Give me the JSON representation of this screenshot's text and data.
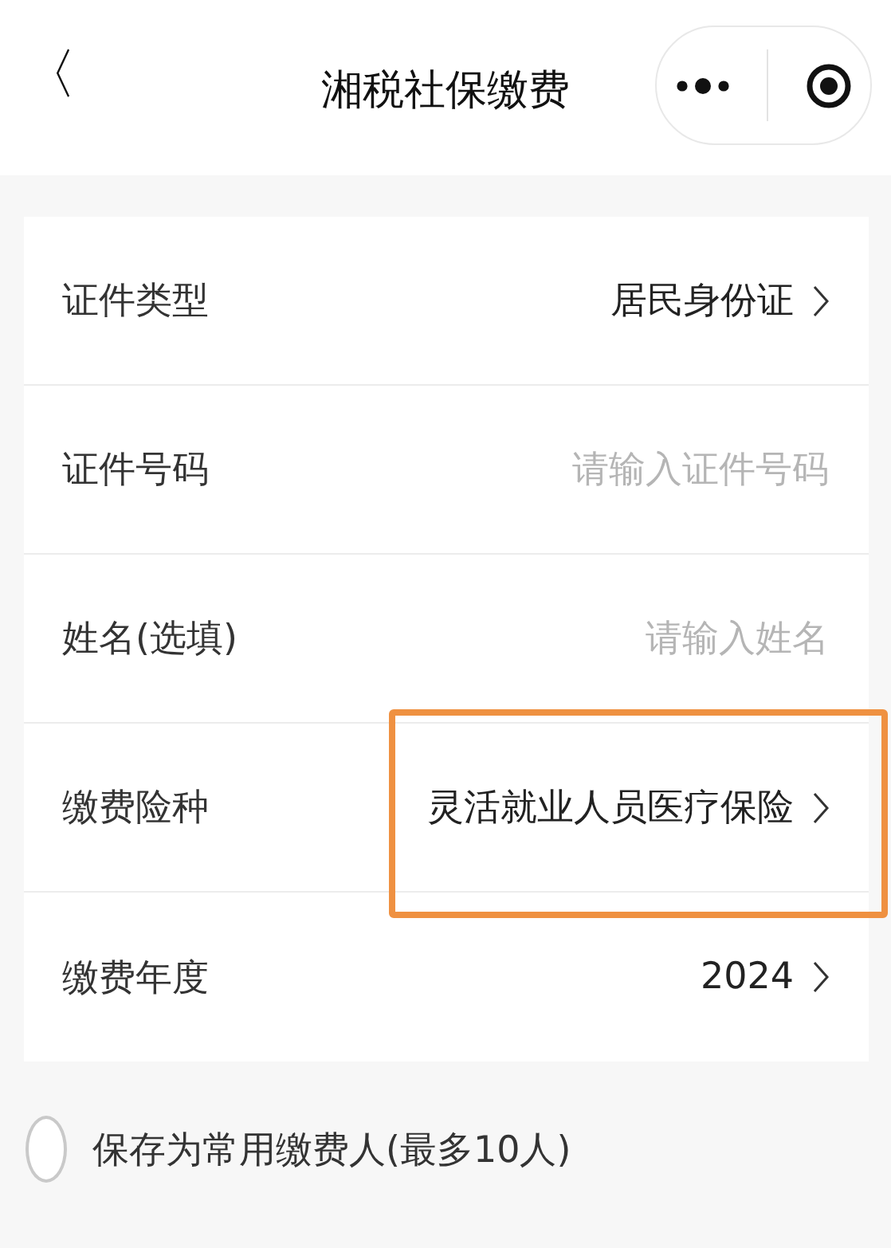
{
  "header": {
    "back_icon": "〈",
    "title": "湘税社保缴费"
  },
  "form": {
    "rows": [
      {
        "kind": "select",
        "label": "证件类型",
        "value": "居民身份证",
        "highlighted": false
      },
      {
        "kind": "input",
        "label": "证件号码",
        "placeholder": "请输入证件号码",
        "highlighted": false
      },
      {
        "kind": "input",
        "label": "姓名(选填)",
        "placeholder": "请输入姓名",
        "highlighted": false
      },
      {
        "kind": "select",
        "label": "缴费险种",
        "value": "灵活就业人员医疗保险",
        "highlighted": true
      },
      {
        "kind": "select",
        "label": "缴费年度",
        "value": "2024",
        "highlighted": false
      }
    ]
  },
  "save_option": {
    "label": "保存为常用缴费人(最多10人)",
    "checked": false
  }
}
